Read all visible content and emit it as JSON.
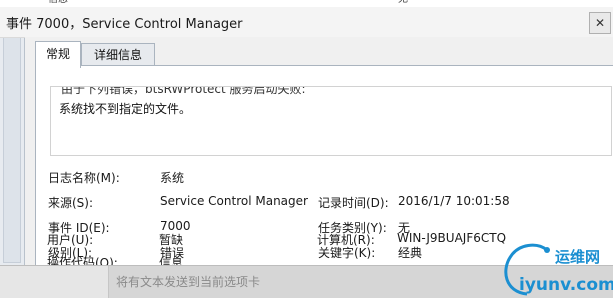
{
  "top_strip": {
    "fragment_left": "信息",
    "fragment_right": "无"
  },
  "window": {
    "title": "事件 7000，Service Control Manager",
    "close_glyph": "✕"
  },
  "tabs": [
    {
      "label": "常规",
      "active": true
    },
    {
      "label": "详细信息",
      "active": false
    }
  ],
  "description": {
    "cut_line": "由于下列错误，btsRWProtect 服务启动失败:",
    "line": "系统找不到指定的文件。"
  },
  "fields": {
    "log_name": {
      "label": "日志名称(M):",
      "value": "系统"
    },
    "source": {
      "label": "来源(S):",
      "value": "Service Control Manager"
    },
    "logged": {
      "label": "记录时间(D):",
      "value": "2016/1/7 10:01:58"
    },
    "event_id": {
      "label": "事件 ID(E):",
      "value": "7000"
    },
    "task_category": {
      "label": "任务类别(Y):",
      "value": "无"
    },
    "level": {
      "label": "级别(L):",
      "value": "错误"
    },
    "keywords": {
      "label": "关键字(K):",
      "value": "经典"
    },
    "user": {
      "label": "用户(U):",
      "value": "暂缺"
    },
    "computer": {
      "label": "计算机(R):",
      "value": "WIN-J9BUAJF6CTQ"
    },
    "opcode": {
      "label": "操作代码(O):",
      "value": "信息"
    }
  },
  "bottom": {
    "hint": "将有文本发送到当前选项卡"
  },
  "watermark": {
    "brand": "运维网",
    "domain": "iyunv.com",
    "color": "#1b8fd1"
  }
}
